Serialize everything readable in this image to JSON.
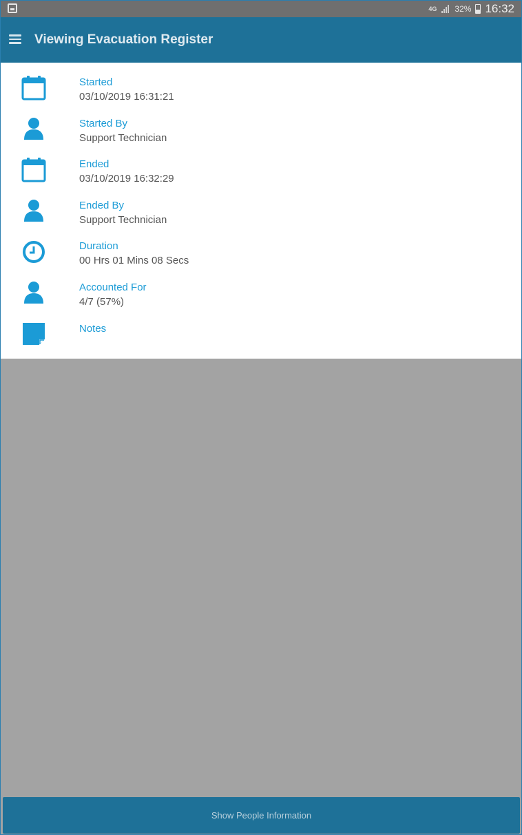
{
  "status_bar": {
    "network": "4G",
    "battery": "32%",
    "time": "16:32"
  },
  "app_bar": {
    "title": "Viewing Evacuation Register"
  },
  "details": [
    {
      "label": "Started",
      "value": "03/10/2019 16:31:21",
      "icon": "calendar-icon"
    },
    {
      "label": "Started By",
      "value": "Support Technician",
      "icon": "person-icon"
    },
    {
      "label": "Ended",
      "value": "03/10/2019 16:32:29",
      "icon": "calendar-icon"
    },
    {
      "label": "Ended By",
      "value": "Support Technician",
      "icon": "person-icon"
    },
    {
      "label": "Duration",
      "value": "00 Hrs 01 Mins 08 Secs",
      "icon": "clock-icon"
    },
    {
      "label": "Accounted For",
      "value": "4/7 (57%)",
      "icon": "person-icon"
    },
    {
      "label": "Notes",
      "value": "",
      "icon": "note-icon"
    }
  ],
  "bottom_button": {
    "label": "Show People Information"
  },
  "colors": {
    "app_bar": "#1e7198",
    "accent": "#1b9bd6",
    "value_text": "#555555",
    "body_background": "#a3a3a3"
  }
}
